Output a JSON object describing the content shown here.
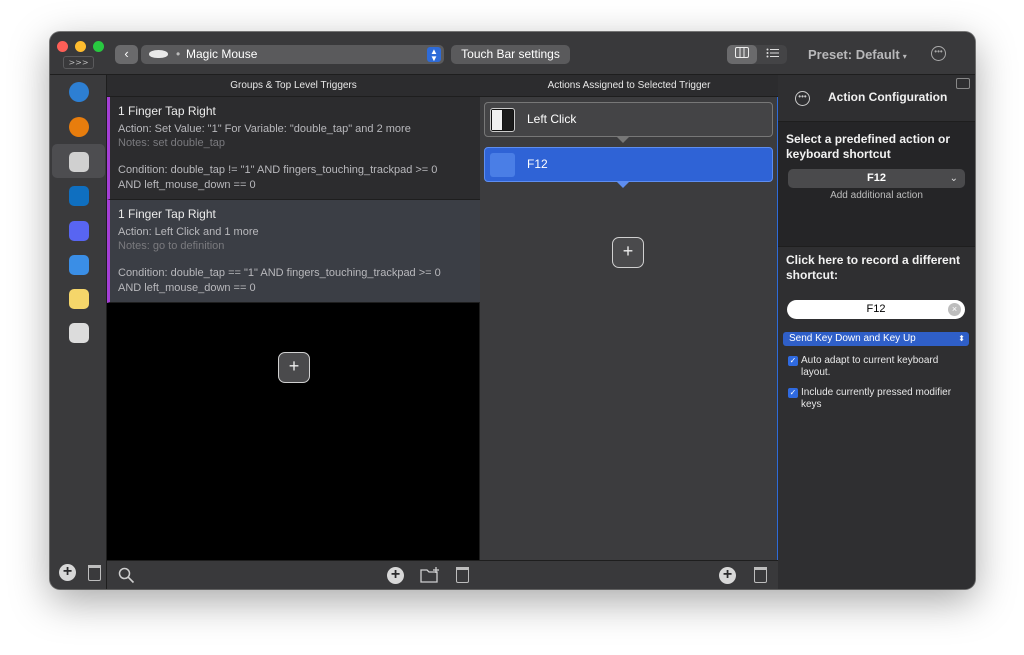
{
  "titlebar": {
    "expand_label": ">>>",
    "back_glyph": "‹",
    "device_select": {
      "dot": "•",
      "label": "Magic Mouse"
    },
    "touchbar_button": "Touch Bar settings",
    "preset_label": "Preset: Default",
    "preset_caret": "▾",
    "more_glyph": "•••"
  },
  "dock": {
    "apps": [
      {
        "name": "globe-app-icon",
        "color": "#2d7fd3"
      },
      {
        "name": "blender-icon",
        "color": "#e87d0d"
      },
      {
        "name": "chrome-window-icon",
        "color": "#d0d0d0"
      },
      {
        "name": "vscode-icon",
        "color": "#0f6fc0"
      },
      {
        "name": "discord-icon",
        "color": "#5865f2"
      },
      {
        "name": "finder-icon",
        "color": "#3a8ee6"
      },
      {
        "name": "notes-icon",
        "color": "#f5d66a"
      },
      {
        "name": "unity-icon",
        "color": "#dcdcdc"
      }
    ]
  },
  "groups": {
    "header": "Groups & Top Level Triggers",
    "triggers": [
      {
        "title": "1 Finger Tap Right",
        "action": "Action: Set Value: \"1\" For Variable: \"double_tap\" and 2 more",
        "notes": "Notes: set double_tap",
        "condition": "Condition: double_tap != \"1\" AND fingers_touching_trackpad >= 0 AND left_mouse_down == 0"
      },
      {
        "title": "1 Finger Tap Right",
        "action": "Action: Left Click and 1 more",
        "notes": "Notes: go to definition",
        "condition": "Condition: double_tap == \"1\" AND fingers_touching_trackpad >= 0 AND left_mouse_down == 0"
      }
    ],
    "add_glyph": "+"
  },
  "actions": {
    "header": "Actions Assigned to Selected Trigger",
    "items": [
      {
        "label": "Left Click"
      },
      {
        "label": "F12"
      }
    ],
    "add_glyph": "+"
  },
  "config": {
    "title": "Action Configuration",
    "more_glyph": "•••",
    "predefined_heading": "Select a predefined action or keyboard shortcut",
    "selected_key": "F12",
    "select_chevron": "⌄",
    "add_additional": "Add additional action",
    "record_heading": "Click here to record a different shortcut:",
    "record_value": "F12",
    "clear_glyph": "×",
    "send_mode": "Send Key Down and Key Up",
    "send_chevron": "⬍",
    "checkboxes": [
      {
        "label": "Auto adapt to current keyboard layout.",
        "checked": true
      },
      {
        "label": "Include currently pressed modifier keys",
        "checked": true
      }
    ],
    "check_glyph": "✓"
  },
  "footer": {
    "search_glyph": "⌕",
    "plus_glyph": "+"
  }
}
